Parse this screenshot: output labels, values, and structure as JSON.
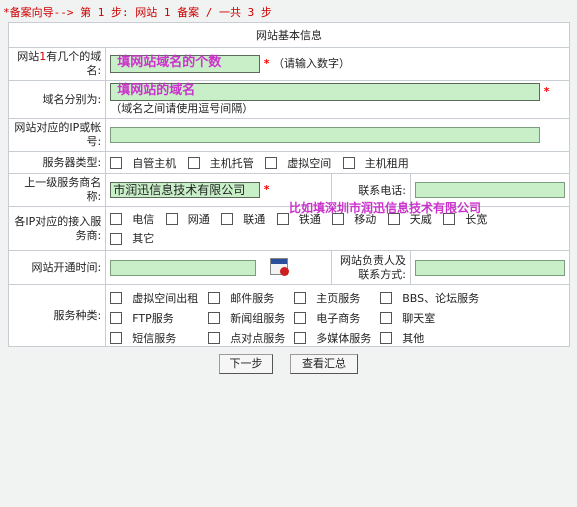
{
  "breadcrumb": "*备案向导-->  第 1 步:  网站 1 备案 / 一共 3 步",
  "form": {
    "title": "网站基本信息",
    "domain_count": {
      "label_pre": "网站",
      "label_num": "1",
      "label_post": "有几个的域名:",
      "overlay": "填网站域名的个数",
      "required": "*",
      "note": "（请输入数字）"
    },
    "domain_names": {
      "label": "域名分别为:",
      "overlay": "填网站的域名",
      "required": "*",
      "note": "（域名之间请使用逗号间隔）"
    },
    "ip_or_account": {
      "label": "网站对应的IP或帐号:"
    },
    "server_type": {
      "label": "服务器类型:",
      "options": [
        "自管主机",
        "主机托管",
        "虚拟空间",
        "主机租用"
      ]
    },
    "provider": {
      "label": "上一级服务商名称:",
      "value": "市润迅信息技术有限公司",
      "required": "*",
      "example": "比如填深圳市润迅信息技术有限公司",
      "phone_label": "联系电话:"
    },
    "isp": {
      "label": "各IP对应的接入服务商:",
      "options": [
        "电信",
        "网通",
        "联通",
        "铁通",
        "移动",
        "天威",
        "长宽",
        "其它"
      ]
    },
    "open_time": {
      "label": "网站开通时间:",
      "calendar_icon": "calendar-icon",
      "contact_label": "网站负责人及联系方式:"
    },
    "service_types": {
      "label": "服务种类:",
      "options": [
        "虚拟空间出租",
        "邮件服务",
        "主页服务",
        "BBS、论坛服务",
        "FTP服务",
        "新闻组服务",
        "电子商务",
        "聊天室",
        "短信服务",
        "点对点服务",
        "多媒体服务",
        "其他"
      ]
    }
  },
  "buttons": {
    "next": "下一步",
    "summary": "查看汇总"
  },
  "colors": {
    "input_bg": "#c9efc9",
    "required": "#ff0000",
    "hint": "#cc33cc",
    "breadcrumb": "#cc0000"
  }
}
